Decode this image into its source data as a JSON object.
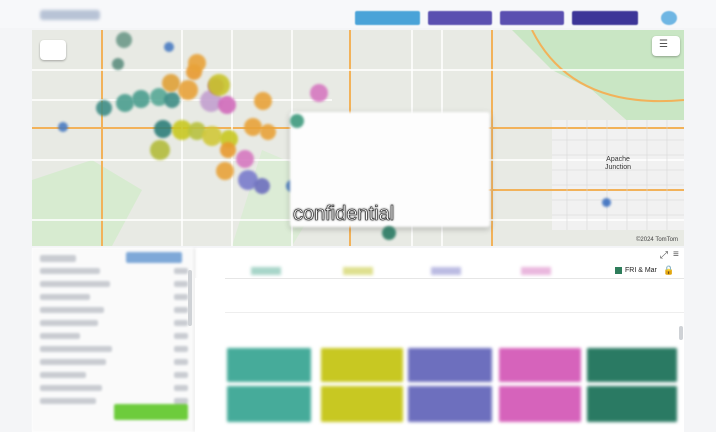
{
  "map": {
    "place_label": "Apache\nJunction",
    "attribution": "©2024 TomTom"
  },
  "watermark": "confidential",
  "timeline": {
    "legend_label": "FRI & Mar",
    "legend_color": "#2e7d5b"
  },
  "colors": {
    "teal": "#46ab9a",
    "yellow": "#c8c822",
    "indigo": "#6d6fbe",
    "pink": "#d663bb",
    "darkgreen": "#2a7a63",
    "green_button": "#6dcc3c",
    "orange_dot": "#e8a33a"
  },
  "icons": {
    "layers": "list-icon",
    "lock": "lock-icon",
    "expand": "expand-icon",
    "menu": "hamburger-icon"
  }
}
